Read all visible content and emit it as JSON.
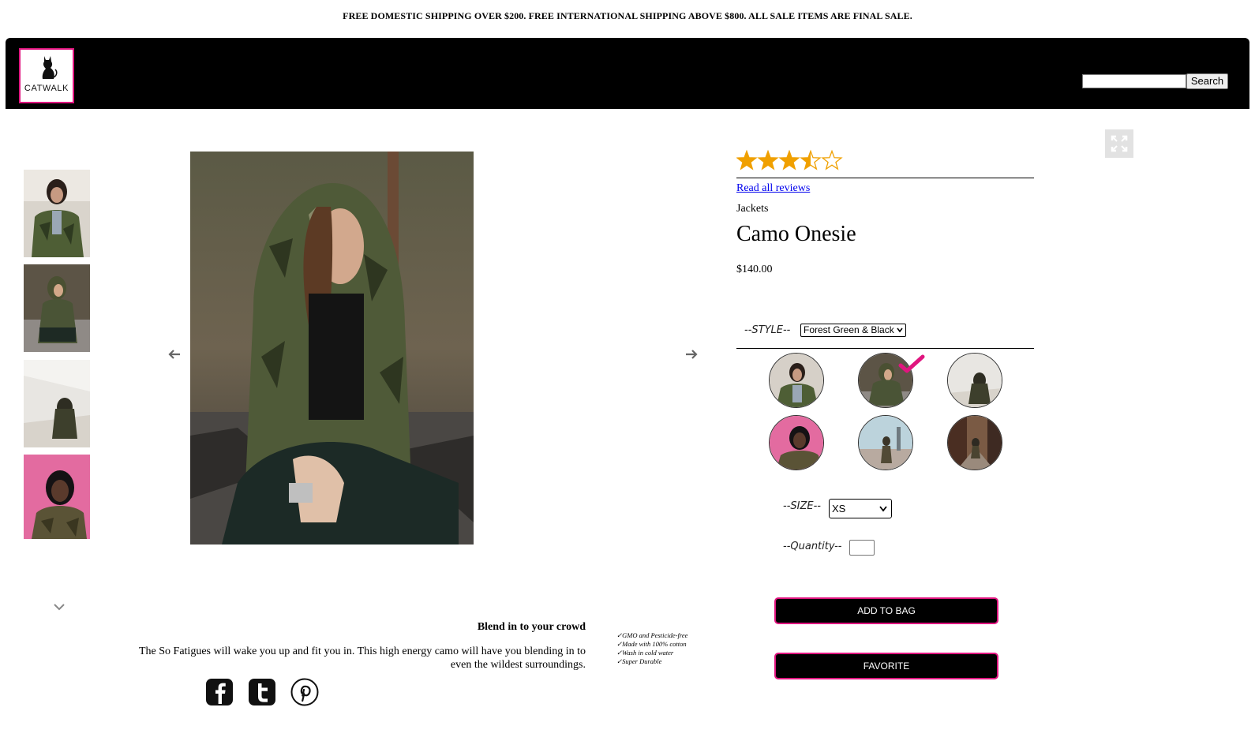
{
  "promo_banner": "FREE DOMESTIC SHIPPING OVER $200. FREE INTERNATIONAL SHIPPING ABOVE $800. ALL SALE ITEMS ARE FINAL SALE.",
  "header": {
    "logo_text": "CATWALK",
    "search": {
      "value": "",
      "button_label": "Search"
    }
  },
  "gallery": {
    "thumbnails": [
      "thumbnail 1",
      "thumbnail 2",
      "thumbnail 3",
      "thumbnail 4"
    ]
  },
  "product": {
    "rating": 3.5,
    "rating_max": 5,
    "reviews_link": "Read all reviews",
    "category": "Jackets",
    "title": "Camo Onesie",
    "price": "$140.00",
    "style_label": "--STYLE--",
    "style_selected": "Forest Green & Black",
    "size_label": "--SIZE--",
    "size_selected": "XS",
    "quantity_label": "--Quantity--",
    "quantity_value": "",
    "add_to_bag": "ADD TO BAG",
    "favorite": "FAVORITE"
  },
  "description": {
    "heading": "Blend in to your crowd",
    "body": "The So Fatigues will wake you up and fit you in. This high energy camo will have you blending in to even the wildest surroundings.",
    "features": [
      "✓GMO and Pesticide-free",
      "✓Made with 100% cotton",
      "✓Wash in cold water",
      "✓Super Durable"
    ]
  },
  "social": [
    "facebook-icon",
    "twitter-icon",
    "pinterest-icon"
  ],
  "colors": {
    "accent": "#e0157f",
    "star": "#f0a000",
    "header_bg": "#000000"
  }
}
